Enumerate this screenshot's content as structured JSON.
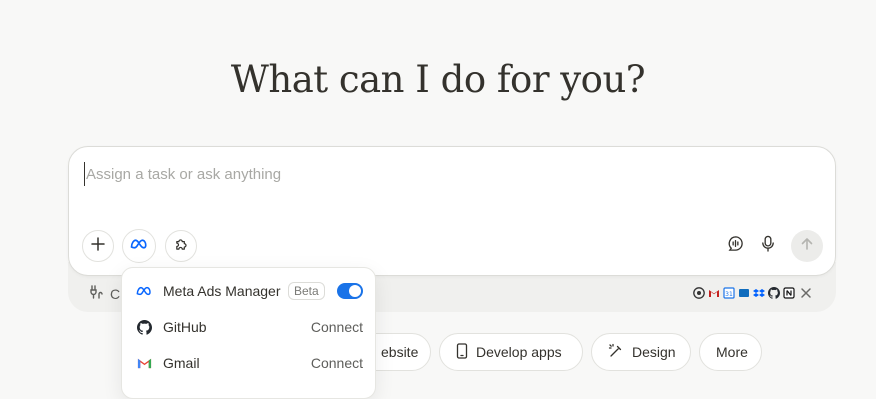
{
  "hero": {
    "title": "What can I do for you?"
  },
  "composer": {
    "placeholder": "Assign a task or ask anything",
    "value": ""
  },
  "connectors_strip": {
    "label_partial": "C",
    "app_icons": [
      "chrome-icon",
      "gmail-icon",
      "calendar-icon",
      "outlook-icon",
      "dropbox-icon",
      "github-icon",
      "notion-icon"
    ]
  },
  "connectors_menu": {
    "items": [
      {
        "icon": "meta-icon",
        "label": "Meta Ads Manager",
        "badge": "Beta",
        "enabled": true
      },
      {
        "icon": "github-icon",
        "label": "GitHub",
        "action": "Connect"
      },
      {
        "icon": "gmail-icon",
        "label": "Gmail",
        "action": "Connect"
      }
    ]
  },
  "quick_actions": [
    {
      "icon": "globe-icon",
      "label": "ebsite"
    },
    {
      "icon": "phone-icon",
      "label": "Develop apps"
    },
    {
      "icon": "design-icon",
      "label": "Design"
    },
    {
      "icon": "",
      "label": "More"
    }
  ],
  "colors": {
    "background": "#f8f8f7",
    "text": "#34322d",
    "toggle_on": "#1a73e8",
    "meta_blue": "#0866ff"
  }
}
